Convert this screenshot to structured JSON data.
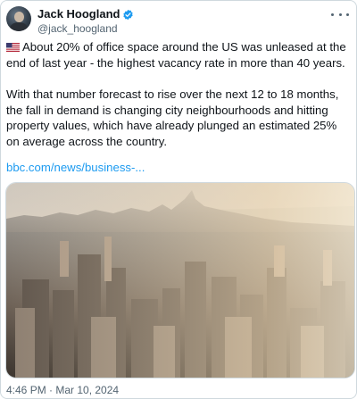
{
  "tweet": {
    "display_name": "Jack Hoogland",
    "handle": "@jack_hoogland",
    "paragraph_1": "About 20% of office space around the US was unleased at the end of last year - the highest vacancy rate in more than 40 years.",
    "paragraph_2": "With that number forecast to rise over the next 12 to 18 months, the fall in demand is changing city neighbourhoods and hitting property values, which have already plunged an estimated 25% on average across the country.",
    "link_text": "bbc.com/news/business-...",
    "timestamp": "4:46 PM · Mar 10, 2024"
  },
  "icons": {
    "verified": "verified-badge-icon",
    "more": "more-options-icon",
    "flag": "us-flag-icon"
  },
  "colors": {
    "text": "#0f1419",
    "secondary": "#536471",
    "link": "#1d9bf0",
    "border": "#cfd9de"
  }
}
